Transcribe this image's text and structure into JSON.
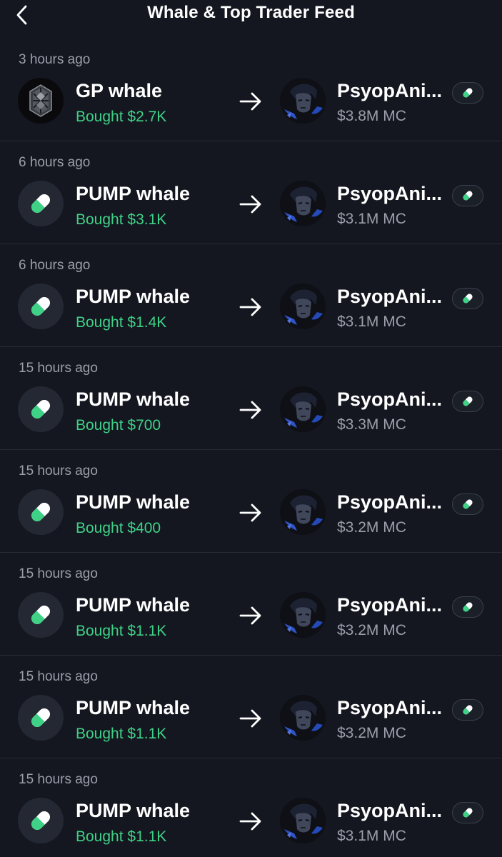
{
  "header": {
    "title": "Whale & Top Trader Feed",
    "back_icon": "chevron-left-icon"
  },
  "colors": {
    "background": "#141720",
    "buy_green": "#3fd186",
    "muted_text": "#9a9fa9",
    "divider": "#262b36"
  },
  "feed": [
    {
      "time": "3 hours ago",
      "trader": "GP whale",
      "trader_avatar": "gp-logo",
      "action": "Bought $2.7K",
      "token": "PsyopAni...",
      "market_cap": "$3.8M MC",
      "badge_icon": "pump-pill-icon"
    },
    {
      "time": "6 hours ago",
      "trader": "PUMP whale",
      "trader_avatar": "pump-pill-icon",
      "action": "Bought $3.1K",
      "token": "PsyopAni...",
      "market_cap": "$3.1M MC",
      "badge_icon": "pump-pill-icon"
    },
    {
      "time": "6 hours ago",
      "trader": "PUMP whale",
      "trader_avatar": "pump-pill-icon",
      "action": "Bought $1.4K",
      "token": "PsyopAni...",
      "market_cap": "$3.1M MC",
      "badge_icon": "pump-pill-icon"
    },
    {
      "time": "15 hours ago",
      "trader": "PUMP whale",
      "trader_avatar": "pump-pill-icon",
      "action": "Bought $700",
      "token": "PsyopAni...",
      "market_cap": "$3.3M MC",
      "badge_icon": "pump-pill-icon"
    },
    {
      "time": "15 hours ago",
      "trader": "PUMP whale",
      "trader_avatar": "pump-pill-icon",
      "action": "Bought $400",
      "token": "PsyopAni...",
      "market_cap": "$3.2M MC",
      "badge_icon": "pump-pill-icon"
    },
    {
      "time": "15 hours ago",
      "trader": "PUMP whale",
      "trader_avatar": "pump-pill-icon",
      "action": "Bought $1.1K",
      "token": "PsyopAni...",
      "market_cap": "$3.2M MC",
      "badge_icon": "pump-pill-icon"
    },
    {
      "time": "15 hours ago",
      "trader": "PUMP whale",
      "trader_avatar": "pump-pill-icon",
      "action": "Bought $1.1K",
      "token": "PsyopAni...",
      "market_cap": "$3.2M MC",
      "badge_icon": "pump-pill-icon"
    },
    {
      "time": "15 hours ago",
      "trader": "PUMP whale",
      "trader_avatar": "pump-pill-icon",
      "action": "Bought $1.1K",
      "token": "PsyopAni...",
      "market_cap": "$3.1M MC",
      "badge_icon": "pump-pill-icon"
    }
  ]
}
